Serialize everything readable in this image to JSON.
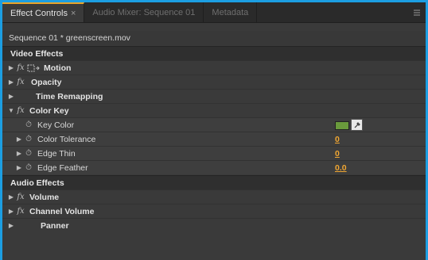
{
  "tabs": [
    {
      "label": "Effect Controls",
      "close": "×",
      "active": true
    },
    {
      "label": "Audio Mixer: Sequence 01",
      "active": false
    },
    {
      "label": "Metadata",
      "active": false
    }
  ],
  "tab_menu_icon": "panel-menu-icon",
  "source": {
    "label": "Sequence 01 * greenscreen.mov"
  },
  "video_section": {
    "label": "Video Effects"
  },
  "audio_section": {
    "label": "Audio Effects"
  },
  "video_effects": [
    {
      "name": "Motion",
      "fx": "fx",
      "expanded": false
    },
    {
      "name": "Opacity",
      "fx": "fx",
      "expanded": false
    },
    {
      "name": "Time Remapping",
      "fx": "",
      "expanded": false
    },
    {
      "name": "Color Key",
      "fx": "fx",
      "expanded": true
    }
  ],
  "color_key_params": [
    {
      "name": "Key Color",
      "value": "",
      "swatch": "#6a9a3c"
    },
    {
      "name": "Color Tolerance",
      "value": "0"
    },
    {
      "name": "Edge Thin",
      "value": "0"
    },
    {
      "name": "Edge Feather",
      "value": "0.0"
    }
  ],
  "audio_effects": [
    {
      "name": "Volume",
      "fx": "fx"
    },
    {
      "name": "Channel Volume",
      "fx": "fx"
    },
    {
      "name": "Panner",
      "fx": ""
    }
  ],
  "colors": {
    "accent_border": "#1c9ee2",
    "value": "#f0a632",
    "active_tab_indicator": "#e8a42b"
  }
}
